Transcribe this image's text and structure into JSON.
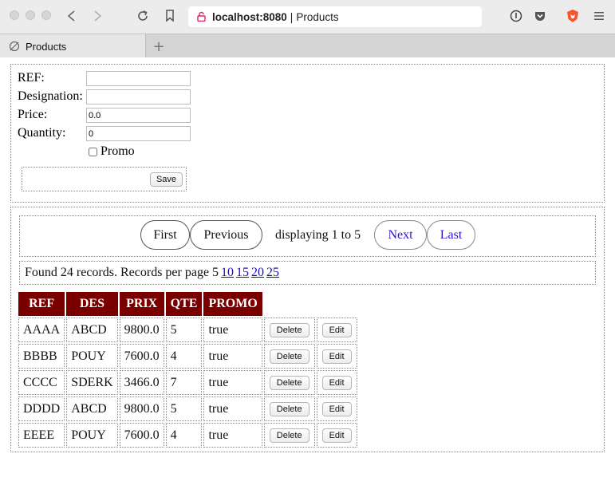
{
  "browser": {
    "url_host": "localhost:8080",
    "url_separator": "|",
    "page_title": "Products",
    "tab_label": "Products",
    "new_tab_symbol": "+"
  },
  "form": {
    "ref_label": "REF:",
    "ref_value": "",
    "designation_label": "Designation:",
    "designation_value": "",
    "price_label": "Price:",
    "price_value": "0.0",
    "quantity_label": "Quantity:",
    "quantity_value": "0",
    "promo_label": "Promo",
    "promo_checked": false,
    "save_label": "Save"
  },
  "pager": {
    "first_label": "First",
    "previous_label": "Previous",
    "display_text": "displaying 1 to 5",
    "next_label": "Next",
    "last_label": "Last"
  },
  "records_info": {
    "text": "Found 24 records. Records per page 5",
    "page_sizes": [
      "10",
      "15",
      "20",
      "25"
    ]
  },
  "table": {
    "columns": [
      "REF",
      "DES",
      "PRIX",
      "QTE",
      "PROMO"
    ],
    "delete_label": "Delete",
    "edit_label": "Edit",
    "rows": [
      [
        "AAAA",
        "ABCD",
        "9800.0",
        "5",
        "true"
      ],
      [
        "BBBB",
        "POUY",
        "7600.0",
        "4",
        "true"
      ],
      [
        "CCCC",
        "SDERK",
        "3466.0",
        "7",
        "true"
      ],
      [
        "DDDD",
        "ABCD",
        "9800.0",
        "5",
        "true"
      ],
      [
        "EEEE",
        "POUY",
        "7600.0",
        "4",
        "true"
      ]
    ]
  },
  "colors": {
    "header_bg": "#7a0000",
    "link": "#1a0dab",
    "inactive_pager": "#3311cc"
  }
}
